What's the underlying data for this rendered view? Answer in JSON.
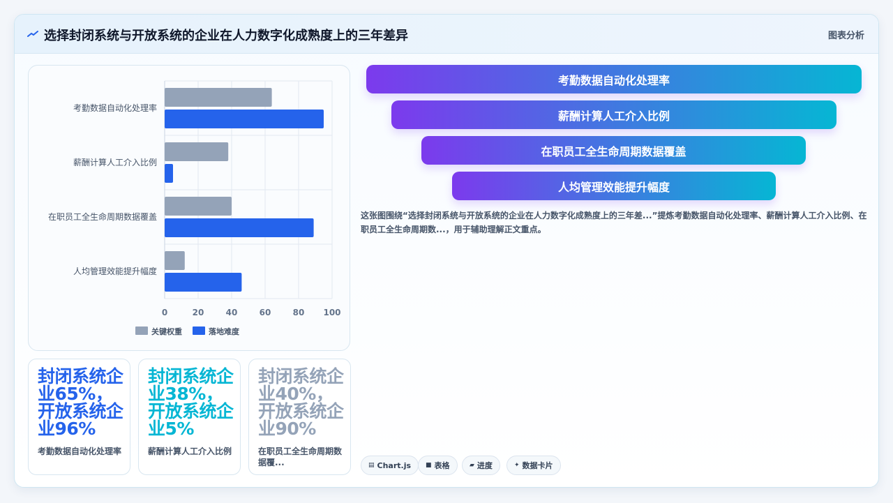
{
  "header": {
    "title": "选择封闭系统与开放系统的企业在人力数字化成熟度上的三年差异",
    "badge": "图表分析"
  },
  "chart_data": {
    "type": "bar",
    "orientation": "horizontal",
    "categories": [
      "考勤数据自动化处理率",
      "薪酬计算人工介入比例",
      "在职员工全生命周期数据覆盖",
      "人均管理效能提升幅度"
    ],
    "series": [
      {
        "name": "关键权重",
        "values": [
          64,
          38,
          40,
          12
        ],
        "color": "#94a3b8"
      },
      {
        "name": "落地难度",
        "values": [
          95,
          5,
          89,
          46
        ],
        "color": "#2563eb"
      }
    ],
    "xlim": [
      0,
      100
    ],
    "xticks": [
      0,
      20,
      40,
      60,
      80,
      100
    ],
    "grid": true,
    "legend": "bottom"
  },
  "metrics": [
    {
      "text": "封闭系统企业65%，开放系统企业96%",
      "label": "考勤数据自动化处理率",
      "color": "#2563eb"
    },
    {
      "text": "封闭系统企业38%，开放系统企业5%",
      "label": "薪酬计算人工介入比例",
      "color": "#06b6d4"
    },
    {
      "text": "封闭系统企业40%，开放系统企业90%",
      "label": "在职员工全生命周期数据覆...",
      "color": "#94a3b8"
    }
  ],
  "funnel": [
    "考勤数据自动化处理率",
    "薪酬计算人工介入比例",
    "在职员工全生命周期数据覆盖",
    "人均管理效能提升幅度"
  ],
  "description": "这张图围绕“选择封闭系统与开放系统的企业在人力数字化成熟度上的三年差...”提炼考勤数据自动化处理率、薪酬计算人工介入比例、在职员工全生命周期数...，用于辅助理解正文重点。",
  "tags": [
    {
      "icon": "chart-icon",
      "label": "Chart.js"
    },
    {
      "icon": "table-icon",
      "label": "表格"
    },
    {
      "icon": "progress-icon",
      "label": "进度"
    },
    {
      "icon": "sparkle-icon",
      "label": "数据卡片"
    }
  ]
}
